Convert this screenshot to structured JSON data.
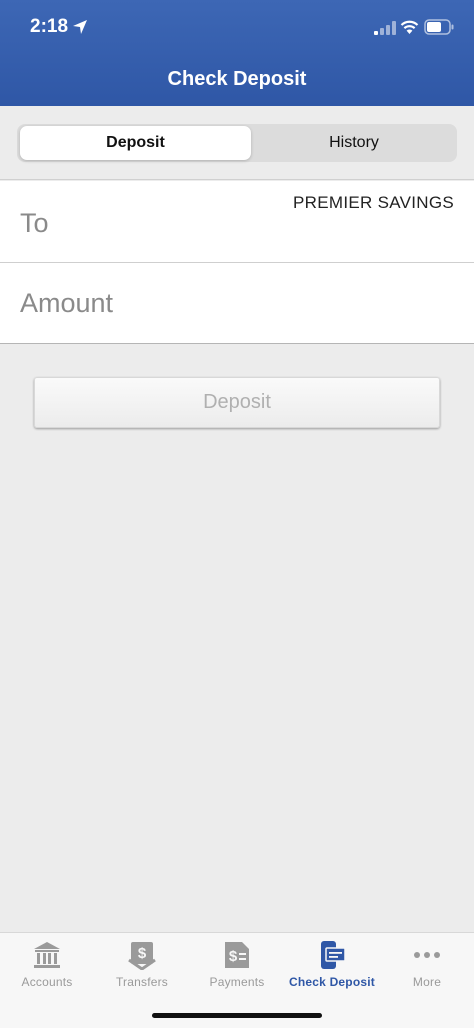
{
  "status_bar": {
    "time": "2:18"
  },
  "header": {
    "title": "Check Deposit"
  },
  "segments": {
    "deposit": "Deposit",
    "history": "History"
  },
  "form": {
    "to_label": "To",
    "to_value": "PREMIER SAVINGS",
    "amount_label": "Amount"
  },
  "deposit_button": "Deposit",
  "tabs": [
    {
      "label": "Accounts",
      "icon": "bank-icon"
    },
    {
      "label": "Transfers",
      "icon": "transfer-icon"
    },
    {
      "label": "Payments",
      "icon": "payment-icon"
    },
    {
      "label": "Check Deposit",
      "icon": "check-deposit-icon"
    },
    {
      "label": "More",
      "icon": "more-icon"
    }
  ],
  "colors": {
    "brand": "#2f57a6",
    "inactive_tab": "#9a9a9a",
    "background": "#ececec"
  }
}
